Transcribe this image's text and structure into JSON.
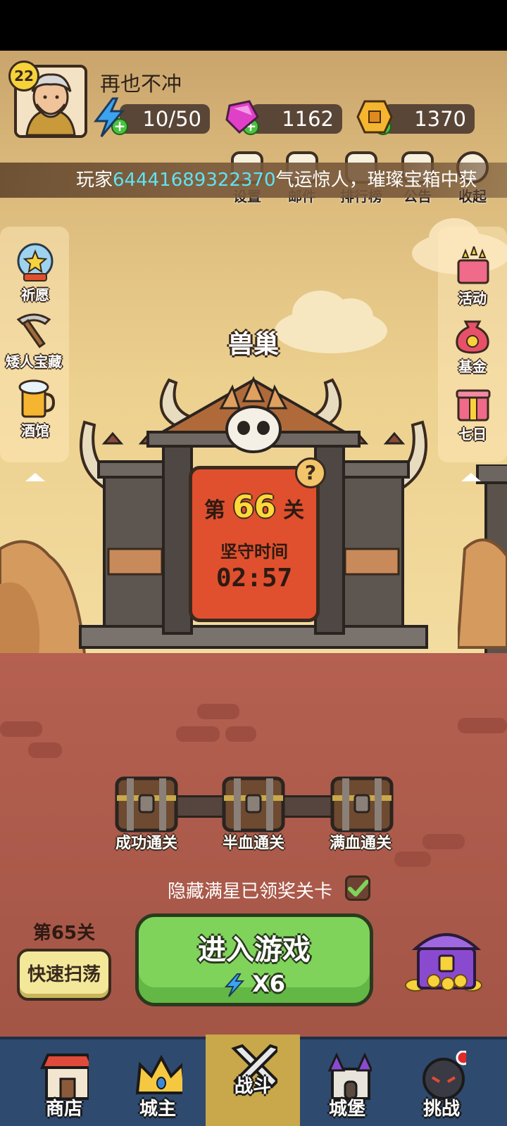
{
  "player": {
    "level": "22",
    "name": "再也不冲",
    "energy": "10/50",
    "gems": "1162",
    "gold": "1370"
  },
  "top_menu": [
    {
      "label": "设置",
      "icon": "gear-icon"
    },
    {
      "label": "邮件",
      "icon": "mail-icon"
    },
    {
      "label": "排行榜",
      "icon": "ranking-icon"
    },
    {
      "label": "公告",
      "icon": "megaphone-icon"
    },
    {
      "label": "收起",
      "icon": "collapse-icon"
    }
  ],
  "ticker": {
    "prefix": "玩家",
    "player_id": "64441689322370",
    "suffix": "气运惊人，璀璨宝箱中获"
  },
  "left_side": [
    {
      "label": "祈愿",
      "icon": "wish-orb-icon"
    },
    {
      "label": "矮人宝藏",
      "icon": "pickaxe-icon"
    },
    {
      "label": "酒馆",
      "icon": "beer-mug-icon"
    }
  ],
  "right_side": [
    {
      "label": "活动",
      "icon": "gift-stars-icon"
    },
    {
      "label": "基金",
      "icon": "money-bag-icon"
    },
    {
      "label": "七日",
      "icon": "gift-box-icon"
    }
  ],
  "stage": {
    "name": "兽巢",
    "level_prefix": "第",
    "level_number": "66",
    "level_suffix": "关",
    "hold_label": "坚守时间",
    "hold_time": "02:57",
    "help": "?"
  },
  "chests": [
    {
      "label": "成功通关"
    },
    {
      "label": "半血通关"
    },
    {
      "label": "满血通关"
    }
  ],
  "hide_option": {
    "label": "隐藏满星已领奖关卡",
    "checked": true
  },
  "sweep": {
    "level_label": "第65关",
    "button_label": "快速扫荡"
  },
  "enter_game": {
    "label": "进入游戏",
    "cost": "X6"
  },
  "bottom_nav": [
    {
      "label": "商店",
      "icon": "shop-icon",
      "active": false
    },
    {
      "label": "城主",
      "icon": "crown-icon",
      "active": false
    },
    {
      "label": "战斗",
      "icon": "crossed-swords-icon",
      "active": true
    },
    {
      "label": "城堡",
      "icon": "castle-icon",
      "active": false
    },
    {
      "label": "挑战",
      "icon": "bomb-icon",
      "active": false
    }
  ],
  "colors": {
    "energy": "#3aa4f0",
    "gem": "#e040c8",
    "gold": "#f5b530",
    "enter_button": "#7fd35a",
    "nav_active": "#c8a84b",
    "nav_bg": "#2f4a6f",
    "ticker_highlight": "#5fe3f2"
  }
}
